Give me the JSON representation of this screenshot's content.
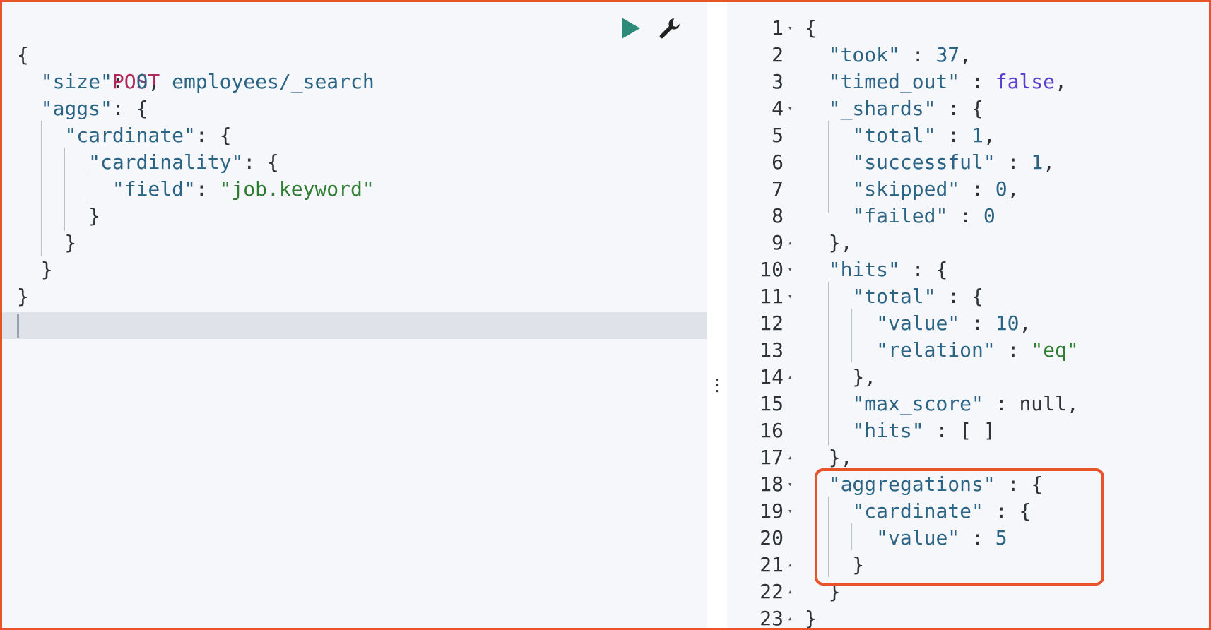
{
  "request": {
    "method": "POST",
    "path": "employees/_search",
    "lines": [
      [
        [
          "{",
          "p"
        ]
      ],
      [
        [
          "  ",
          "p"
        ],
        [
          "\"size\"",
          "k"
        ],
        [
          ": ",
          "p"
        ],
        [
          "0",
          "n"
        ],
        [
          ",",
          "p"
        ]
      ],
      [
        [
          "  ",
          "p"
        ],
        [
          "\"aggs\"",
          "k"
        ],
        [
          ": {",
          "p"
        ]
      ],
      [
        [
          "    ",
          "p"
        ],
        [
          "\"cardinate\"",
          "k"
        ],
        [
          ": {",
          "p"
        ]
      ],
      [
        [
          "      ",
          "p"
        ],
        [
          "\"cardinality\"",
          "k"
        ],
        [
          ": {",
          "p"
        ]
      ],
      [
        [
          "        ",
          "p"
        ],
        [
          "\"field\"",
          "k"
        ],
        [
          ": ",
          "p"
        ],
        [
          "\"job.keyword\"",
          "s"
        ]
      ],
      [
        [
          "      }",
          "p"
        ]
      ],
      [
        [
          "    }",
          "p"
        ]
      ],
      [
        [
          "  }",
          "p"
        ]
      ],
      [
        [
          "}",
          "p"
        ]
      ]
    ]
  },
  "response": {
    "lines": [
      {
        "num": "1",
        "fold": "open",
        "tokens": [
          [
            "{",
            "p"
          ]
        ]
      },
      {
        "num": "2",
        "fold": "",
        "tokens": [
          [
            "  ",
            "p"
          ],
          [
            "\"took\"",
            "k"
          ],
          [
            " : ",
            "p"
          ],
          [
            "37",
            "n"
          ],
          [
            ",",
            "p"
          ]
        ]
      },
      {
        "num": "3",
        "fold": "",
        "tokens": [
          [
            "  ",
            "p"
          ],
          [
            "\"timed_out\"",
            "k"
          ],
          [
            " : ",
            "p"
          ],
          [
            "false",
            "b"
          ],
          [
            ",",
            "p"
          ]
        ]
      },
      {
        "num": "4",
        "fold": "open",
        "tokens": [
          [
            "  ",
            "p"
          ],
          [
            "\"_shards\"",
            "k"
          ],
          [
            " : {",
            "p"
          ]
        ]
      },
      {
        "num": "5",
        "fold": "",
        "tokens": [
          [
            "    ",
            "p"
          ],
          [
            "\"total\"",
            "k"
          ],
          [
            " : ",
            "p"
          ],
          [
            "1",
            "n"
          ],
          [
            ",",
            "p"
          ]
        ]
      },
      {
        "num": "6",
        "fold": "",
        "tokens": [
          [
            "    ",
            "p"
          ],
          [
            "\"successful\"",
            "k"
          ],
          [
            " : ",
            "p"
          ],
          [
            "1",
            "n"
          ],
          [
            ",",
            "p"
          ]
        ]
      },
      {
        "num": "7",
        "fold": "",
        "tokens": [
          [
            "    ",
            "p"
          ],
          [
            "\"skipped\"",
            "k"
          ],
          [
            " : ",
            "p"
          ],
          [
            "0",
            "n"
          ],
          [
            ",",
            "p"
          ]
        ]
      },
      {
        "num": "8",
        "fold": "",
        "tokens": [
          [
            "    ",
            "p"
          ],
          [
            "\"failed\"",
            "k"
          ],
          [
            " : ",
            "p"
          ],
          [
            "0",
            "n"
          ]
        ]
      },
      {
        "num": "9",
        "fold": "close",
        "tokens": [
          [
            "  },",
            "p"
          ]
        ]
      },
      {
        "num": "10",
        "fold": "open",
        "tokens": [
          [
            "  ",
            "p"
          ],
          [
            "\"hits\"",
            "k"
          ],
          [
            " : {",
            "p"
          ]
        ]
      },
      {
        "num": "11",
        "fold": "open",
        "tokens": [
          [
            "    ",
            "p"
          ],
          [
            "\"total\"",
            "k"
          ],
          [
            " : {",
            "p"
          ]
        ]
      },
      {
        "num": "12",
        "fold": "",
        "tokens": [
          [
            "      ",
            "p"
          ],
          [
            "\"value\"",
            "k"
          ],
          [
            " : ",
            "p"
          ],
          [
            "10",
            "n"
          ],
          [
            ",",
            "p"
          ]
        ]
      },
      {
        "num": "13",
        "fold": "",
        "tokens": [
          [
            "      ",
            "p"
          ],
          [
            "\"relation\"",
            "k"
          ],
          [
            " : ",
            "p"
          ],
          [
            "\"eq\"",
            "s"
          ]
        ]
      },
      {
        "num": "14",
        "fold": "close",
        "tokens": [
          [
            "    },",
            "p"
          ]
        ]
      },
      {
        "num": "15",
        "fold": "",
        "tokens": [
          [
            "    ",
            "p"
          ],
          [
            "\"max_score\"",
            "k"
          ],
          [
            " : ",
            "p"
          ],
          [
            "null",
            "p"
          ],
          [
            ",",
            "p"
          ]
        ]
      },
      {
        "num": "16",
        "fold": "",
        "tokens": [
          [
            "    ",
            "p"
          ],
          [
            "\"hits\"",
            "k"
          ],
          [
            " : [ ]",
            "p"
          ]
        ]
      },
      {
        "num": "17",
        "fold": "close",
        "tokens": [
          [
            "  },",
            "p"
          ]
        ]
      },
      {
        "num": "18",
        "fold": "open",
        "tokens": [
          [
            "  ",
            "p"
          ],
          [
            "\"aggregations\"",
            "k"
          ],
          [
            " : {",
            "p"
          ]
        ]
      },
      {
        "num": "19",
        "fold": "open",
        "tokens": [
          [
            "    ",
            "p"
          ],
          [
            "\"cardinate\"",
            "k"
          ],
          [
            " : {",
            "p"
          ]
        ]
      },
      {
        "num": "20",
        "fold": "",
        "tokens": [
          [
            "      ",
            "p"
          ],
          [
            "\"value\"",
            "k"
          ],
          [
            " : ",
            "p"
          ],
          [
            "5",
            "n"
          ]
        ]
      },
      {
        "num": "21",
        "fold": "close",
        "tokens": [
          [
            "    }",
            "p"
          ]
        ]
      },
      {
        "num": "22",
        "fold": "close",
        "tokens": [
          [
            "  }",
            "p"
          ]
        ]
      },
      {
        "num": "23",
        "fold": "close",
        "tokens": [
          [
            "}",
            "p"
          ]
        ]
      }
    ]
  },
  "icons": {
    "run": "play-icon",
    "settings": "wrench-icon",
    "resize": "vertical-ellipsis-icon"
  },
  "colors": {
    "highlight": "#e8532b",
    "key": "#2b6485",
    "string": "#2e7d32",
    "boolean": "#5c3fd1",
    "method": "#b02a5c"
  }
}
